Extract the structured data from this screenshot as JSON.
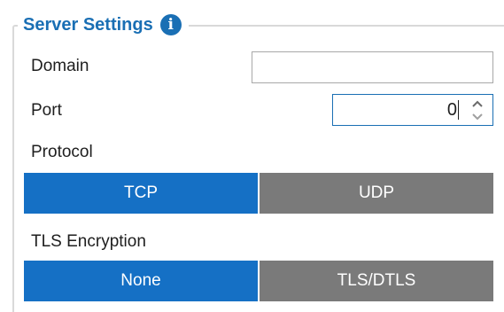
{
  "group": {
    "title": "Server Settings",
    "info_icon": "info-icon"
  },
  "fields": {
    "domain_label": "Domain",
    "domain_value": "",
    "port_label": "Port",
    "port_value": "0",
    "protocol_label": "Protocol",
    "tls_label": "TLS Encryption"
  },
  "protocol": {
    "options": [
      "TCP",
      "UDP"
    ],
    "selected": "TCP"
  },
  "tls": {
    "options": [
      "None",
      "TLS/DTLS"
    ],
    "selected": "None"
  },
  "colors": {
    "accent": "#1570c5",
    "title": "#1a6fb4",
    "inactive": "#7a7a7a",
    "border": "#d9d9d9"
  }
}
